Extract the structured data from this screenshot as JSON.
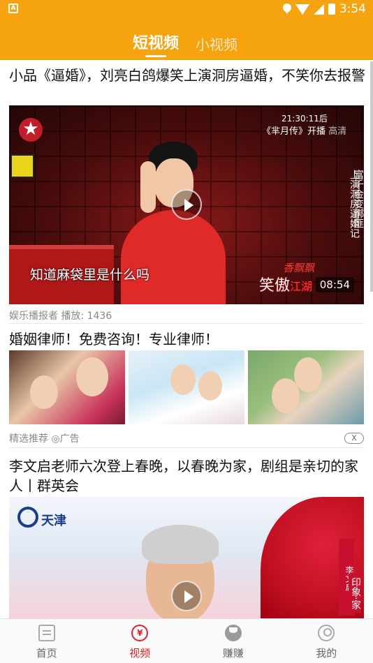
{
  "status_bar": {
    "time": "3:54",
    "left_icon": "A"
  },
  "header": {
    "tabs": [
      {
        "label": "短视频",
        "active": true
      },
      {
        "label": "小视频",
        "active": false
      }
    ]
  },
  "feed": {
    "items": [
      {
        "title": "小品《逼婚》，刘亮白鸽爆笑上演洞房逼婚，不笑你去报警",
        "source": "娱乐播报者",
        "plays": "播放: 1436",
        "duration": "08:54",
        "overlay": {
          "time": "21:30:11后",
          "program": "《芈月传》开播",
          "program_suffix": "高清",
          "vertical_1": "上演洞房逼婚记",
          "vertical_2": "富千金变绑匪",
          "subtitle": "知道麻袋里是什么吗",
          "brand": "笑傲",
          "brand_2": "江湖",
          "brand_3": "香飘飘"
        }
      },
      {
        "title": "婚姻律师！免费咨询！专业律师！",
        "tag": "精选推荐",
        "ad_label": "广告",
        "close_label": "X"
      },
      {
        "title": "李文启老师六次登上春晚，以春晚为家，剧组是亲切的家人丨群英会",
        "overlay": {
          "channel": "天津",
          "vertical_1": "李文启",
          "vertical_2": "印象·家"
        }
      }
    ]
  },
  "bottom_nav": {
    "items": [
      {
        "label": "首页",
        "icon": "home-icon",
        "active": false
      },
      {
        "label": "视频",
        "icon": "video-icon",
        "active": true
      },
      {
        "label": "赚赚",
        "icon": "earn-icon",
        "active": false
      },
      {
        "label": "我的",
        "icon": "profile-icon",
        "active": false
      }
    ]
  },
  "colors": {
    "header": "#f5a30f",
    "accent": "#d8232a"
  }
}
